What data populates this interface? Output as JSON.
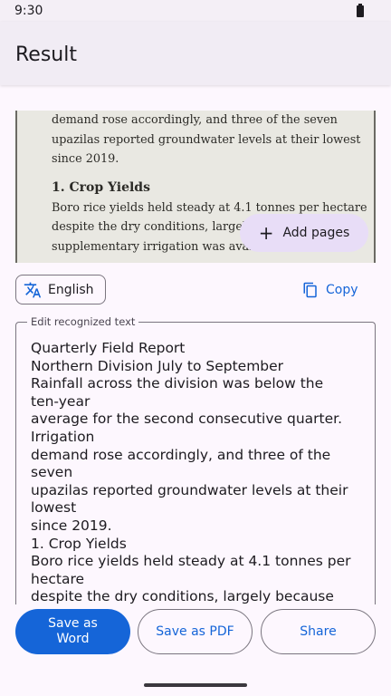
{
  "status_bar": {
    "time": "9:30"
  },
  "app_bar": {
    "title": "Result"
  },
  "scan_preview": {
    "lines_top": [
      "demand rose accordingly, and three of the seven",
      "upazilas reported groundwater levels at their lowest",
      "since 2019."
    ],
    "heading": "1. Crop Yields",
    "lines_bottom": [
      "Boro rice yields held steady at 4.1 tonnes per hectare",
      "despite the dry conditions, largely be",
      "supplementary irrigation was available."
    ],
    "add_pages_label": "Add pages"
  },
  "toolbar": {
    "language_label": "English",
    "copy_label": "Copy"
  },
  "editor": {
    "label": "Edit recognized text",
    "value": "Quarterly Field Report\nNorthern Division July to September\nRainfall across the division was below the\nten-year\naverage for the second consecutive quarter.\nIrrigation\ndemand rose accordingly, and three of the\nseven\nupazilas reported groundwater levels at their\nlowest\nsince 2019.\n1. Crop Yields\nBoro rice yields held steady at 4.1 tonnes per\nhectare\ndespite the dry conditions, largely because"
  },
  "actions": {
    "word_label": "Save as Word",
    "pdf_label": "Save as PDF",
    "share_label": "Share"
  },
  "colors": {
    "accent": "#1565d8",
    "tonal_button": "#e8ddf7",
    "background": "#fdf7fe"
  },
  "icons": [
    "battery-icon",
    "plus-icon",
    "translate-icon",
    "copy-icon"
  ]
}
